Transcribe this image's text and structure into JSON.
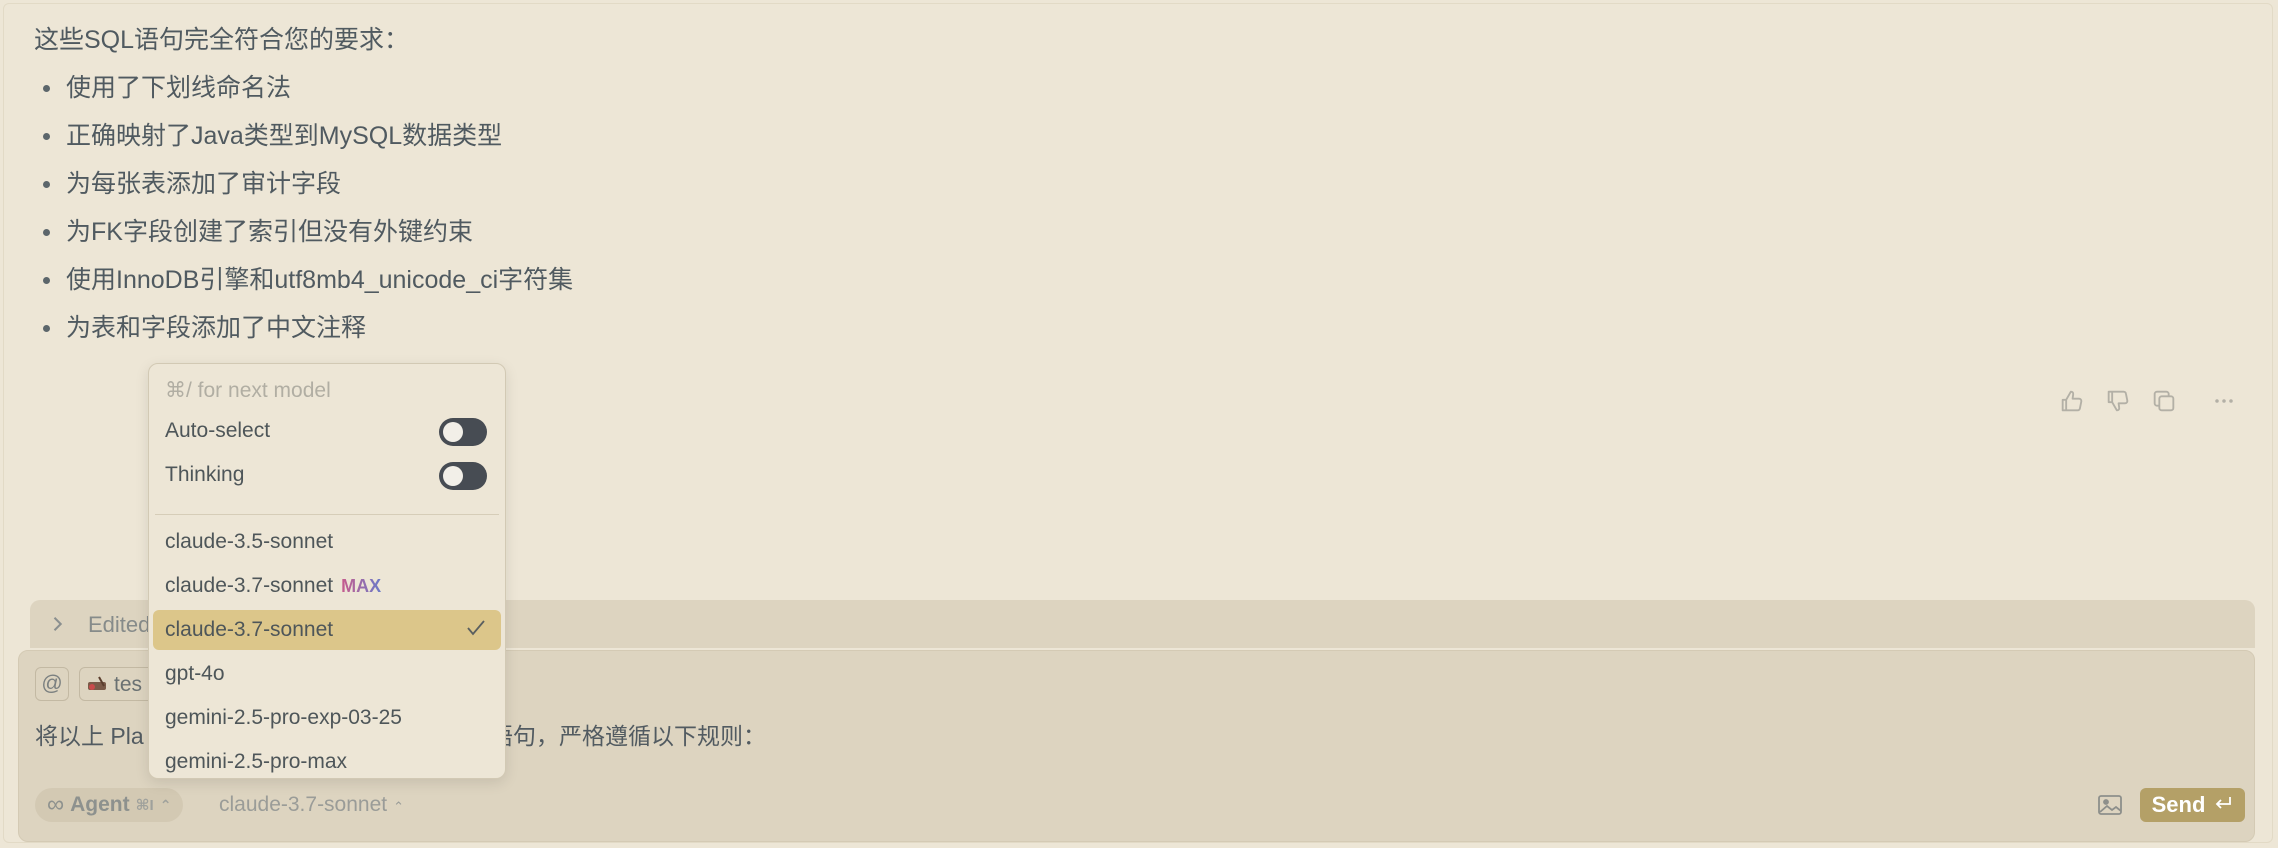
{
  "message": {
    "intro": "这些SQL语句完全符合您的要求：",
    "bullets": [
      "使用了下划线命名法",
      "正确映射了Java类型到MySQL数据类型",
      "为每张表添加了审计字段",
      "为FK字段创建了索引但没有外键约束",
      "使用InnoDB引擎和utf8mb4_unicode_ci字符集",
      "为表和字段添加了中文注释"
    ],
    "actions": [
      "thumbs-up-icon",
      "thumbs-down-icon",
      "copy-icon",
      "more-icon"
    ]
  },
  "composer": {
    "edited_label": "Edited",
    "at_symbol": "@",
    "file_chip_label": "tes",
    "prompt_start": "将以上 Pla",
    "prompt_end": "L 建表语句，严格遵循以下规则：",
    "agent_label": "Agent",
    "agent_shortcut": "⌘I",
    "model_label": "claude-3.7-sonnet",
    "send_label": "Send"
  },
  "model_dropdown": {
    "hint": "⌘/ for next model",
    "toggles": [
      {
        "label": "Auto-select",
        "on": false
      },
      {
        "label": "Thinking",
        "on": false
      }
    ],
    "models": [
      {
        "label": "claude-3.5-sonnet",
        "badge": "",
        "selected": false
      },
      {
        "label": "claude-3.7-sonnet",
        "badge": "MAX",
        "selected": false
      },
      {
        "label": "claude-3.7-sonnet",
        "badge": "",
        "selected": true
      },
      {
        "label": "gpt-4o",
        "badge": "",
        "selected": false
      },
      {
        "label": "gemini-2.5-pro-exp-03-25",
        "badge": "",
        "selected": false
      },
      {
        "label": "gemini-2.5-pro-max",
        "badge": "",
        "selected": false
      }
    ]
  },
  "colors": {
    "background": "#ede6d6",
    "composer": "#ddd4c0",
    "selected_row": "#dcc68a",
    "send_button": "#b4a067",
    "toggle_off": "#474c53"
  }
}
